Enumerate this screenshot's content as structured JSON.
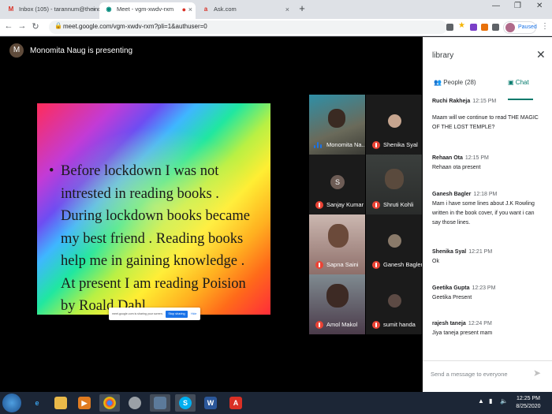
{
  "browser": {
    "tabs": [
      {
        "label": "Inbox (105) - tarannum@theindi",
        "icon": "gmail-icon",
        "color": "#d93025"
      },
      {
        "label": "Meet - vgm-xwdv-rxm",
        "icon": "meet-icon",
        "color": "#00897b"
      },
      {
        "label": "Ask.com",
        "icon": "ask-icon",
        "color": "#d93025"
      }
    ],
    "url": "meet.google.com/vgm-xwdv-rxm?pli=1&authuser=0",
    "profile_status": "Paused"
  },
  "meet": {
    "presenter_initial": "M",
    "presenting_text": "Monomita Naug is presenting",
    "slide": {
      "bullet": "•",
      "lines": [
        "Before lockdown I was not",
        "intrested in reading books .",
        "During lockdown books became",
        "my best friend . Reading books",
        "help me in gaining knowledge .",
        "At present I am reading Poision",
        "by Roald Dahl ."
      ]
    },
    "share_bar": {
      "message": "meet.google.com is sharing your screen.",
      "stop": "Stop sharing",
      "hide": "Hide"
    },
    "participants": [
      {
        "name": "Monomita Na...",
        "speaking": true
      },
      {
        "name": "Shenika Syal",
        "speaking": false
      },
      {
        "name": "Sanjay Kumar",
        "initial": "S",
        "speaking": false
      },
      {
        "name": "Shruti Kohli",
        "speaking": false
      },
      {
        "name": "Sapna Saini",
        "speaking": false
      },
      {
        "name": "Ganesh Bagler",
        "speaking": false
      },
      {
        "name": "Amol Makol",
        "speaking": false
      },
      {
        "name": "sumit handa",
        "speaking": false
      }
    ]
  },
  "sidebar": {
    "title": "library",
    "people_tab": "People (28)",
    "chat_tab": "Chat",
    "messages": [
      {
        "sender": "Ruchi Rakheja",
        "time": "12:15 PM",
        "lines": [
          "Maam will we continue to read THE MAGIC",
          "OF THE LOST TEMPLE?"
        ]
      },
      {
        "sender": "Rehaan Ota",
        "time": "12:15 PM",
        "lines": [
          "Rehaan ota present"
        ]
      },
      {
        "sender": "Ganesh Bagler",
        "time": "12:18 PM",
        "lines": [
          "Mam i have some lines about J.K Rowling",
          "written in the book cover, if you want i can",
          "say those lines."
        ]
      },
      {
        "sender": "Shenika Syal",
        "time": "12:21 PM",
        "lines": [
          "Ok"
        ]
      },
      {
        "sender": "Geetika Gupta",
        "time": "12:23 PM",
        "lines": [
          "Geetika Present"
        ]
      },
      {
        "sender": "rajesh taneja",
        "time": "12:24 PM",
        "lines": [
          "Jiya taneja present mam"
        ]
      }
    ],
    "input_placeholder": "Send a message to everyone"
  },
  "taskbar": {
    "time": "12:25 PM",
    "date": "8/25/2020"
  }
}
